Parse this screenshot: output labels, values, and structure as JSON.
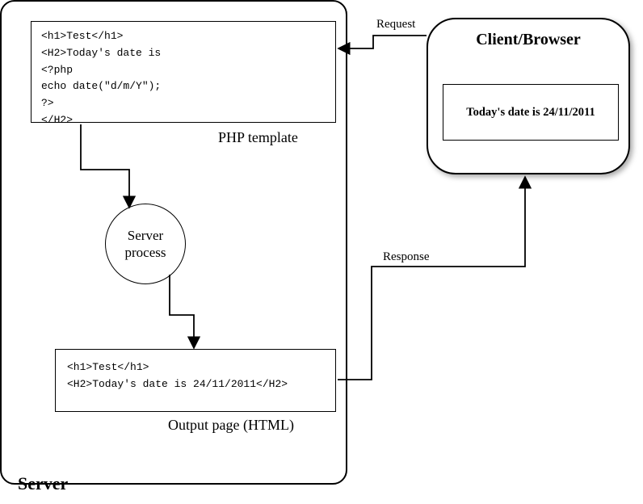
{
  "server": {
    "label": "Server",
    "template": {
      "label": "PHP template",
      "lines": [
        "<h1>Test</h1>",
        "<H2>Today's date is",
        "<?php",
        "echo date(\"d/m/Y\");",
        "?>",
        "</H2>"
      ]
    },
    "process": {
      "label": "Server\nprocess"
    },
    "output": {
      "label": "Output page (HTML)",
      "lines": [
        "<h1>Test</h1>",
        "<H2>Today's date is 24/11/2011</H2>"
      ]
    }
  },
  "client": {
    "label": "Client/Browser",
    "rendered_text": "Today's date is 24/11/2011"
  },
  "edges": {
    "request": "Request",
    "response": "Response"
  }
}
